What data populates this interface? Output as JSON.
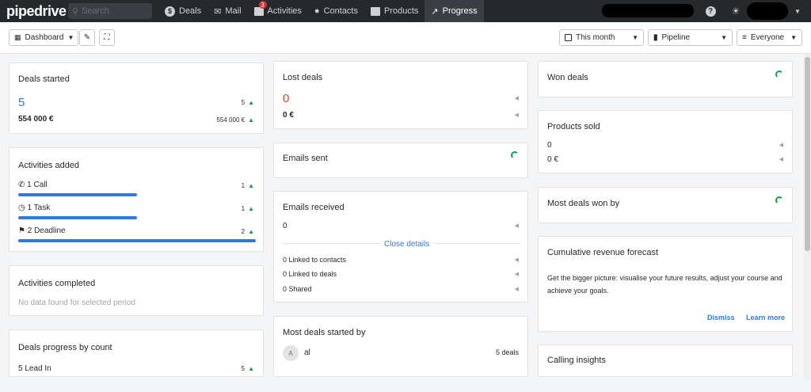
{
  "topbar": {
    "logo": "pipedrive",
    "search_placeholder": "Search",
    "nav": [
      {
        "label": "Deals"
      },
      {
        "label": "Mail"
      },
      {
        "label": "Activities",
        "badge": "3"
      },
      {
        "label": "Contacts"
      },
      {
        "label": "Products"
      },
      {
        "label": "Progress"
      }
    ]
  },
  "toolbar": {
    "dashboard_label": "Dashboard",
    "period_label": "This month",
    "pipeline_label": "Pipeline",
    "owner_label": "Everyone"
  },
  "deals_started": {
    "title": "Deals started",
    "count": "5",
    "count_delta": "5",
    "amount": "554 000 €",
    "amount_delta": "554 000 €"
  },
  "activities_added": {
    "title": "Activities added",
    "items": [
      {
        "label": "1 Call",
        "delta": "1",
        "fill": 0.5
      },
      {
        "label": "1 Task",
        "delta": "1",
        "fill": 0.5
      },
      {
        "label": "2 Deadline",
        "delta": "2",
        "fill": 1.0
      }
    ]
  },
  "activities_completed": {
    "title": "Activities completed",
    "empty_text": "No data found for selected period"
  },
  "deals_progress": {
    "title": "Deals progress by count",
    "items": [
      {
        "label": "5 Lead In",
        "delta": "5"
      }
    ]
  },
  "lost_deals": {
    "title": "Lost deals",
    "count": "0",
    "amount": "0 €"
  },
  "emails_sent": {
    "title": "Emails sent"
  },
  "emails_received": {
    "title": "Emails received",
    "count": "0",
    "close_details": "Close details",
    "linked_contacts": "0 Linked to contacts",
    "linked_deals": "0 Linked to deals",
    "shared": "0 Shared"
  },
  "most_deals_started": {
    "title": "Most deals started by",
    "avatar_letter": "A",
    "user": "al",
    "deals": "5 deals"
  },
  "won_deals": {
    "title": "Won deals"
  },
  "products_sold": {
    "title": "Products sold",
    "count": "0",
    "amount": "0 €"
  },
  "most_deals_won": {
    "title": "Most deals won by"
  },
  "forecast": {
    "title": "Cumulative revenue forecast",
    "body": "Get the bigger picture: visualise your future results, adjust your course and achieve your goals.",
    "dismiss": "Dismiss",
    "learn_more": "Learn more"
  },
  "calling_insights": {
    "title": "Calling insights"
  },
  "colors": {
    "accent": "#317ae2",
    "positive": "#08a742",
    "negative": "#e0452c",
    "topbar": "#26292c"
  }
}
